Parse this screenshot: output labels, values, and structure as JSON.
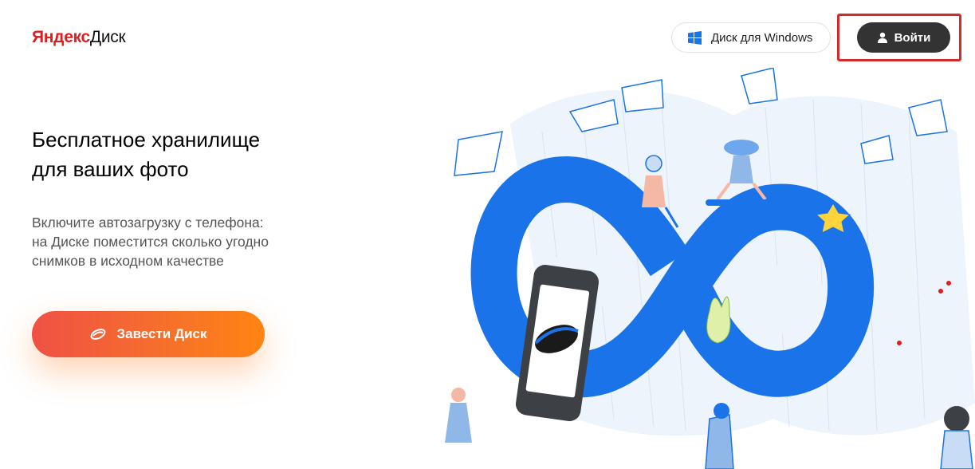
{
  "header": {
    "logo_brand": "Яндекс",
    "logo_product": "Диск",
    "windows_button_label": "Диск для Windows",
    "login_button_label": "Войти"
  },
  "main": {
    "headline_line1": "Бесплатное хранилище",
    "headline_line2": "для ваших фото",
    "subtext_line1": "Включите автозагрузку с телефона:",
    "subtext_line2": "на Диске поместится сколько угодно",
    "subtext_line3": "снимков в исходном качестве",
    "cta_label": "Завести Диск"
  },
  "colors": {
    "accent_blue": "#1a73e8",
    "login_bg": "#333333",
    "cta_start": "#ef5145",
    "cta_end": "#ff8412",
    "highlight": "#d32b2b",
    "logo_red": "#e11d1d"
  },
  "icons": {
    "windows": "windows-icon",
    "user": "user-icon",
    "disk": "disk-icon"
  }
}
